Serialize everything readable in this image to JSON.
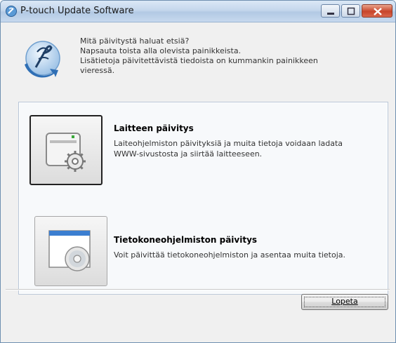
{
  "window": {
    "title": "P-touch Update Software"
  },
  "intro": {
    "line1": "Mitä päivitystä haluat etsiä?",
    "line2": "Napsauta toista alla olevista painikkeista.",
    "line3": "Lisätietoja päivitettävistä tiedoista on kummankin painikkeen",
    "line4": "vieressä."
  },
  "options": [
    {
      "title": "Laitteen päivitys",
      "desc_line1": "Laiteohjelmiston päivityksiä ja muita tietoja voidaan ladata",
      "desc_line2": "WWW-sivustosta ja siirtää laitteeseen.",
      "icon": "device-gear-icon"
    },
    {
      "title": "Tietokoneohjelmiston päivitys",
      "desc_line1": "Voit päivittää tietokoneohjelmiston ja asentaa muita tietoja.",
      "icon": "computer-cd-icon"
    }
  ],
  "footer": {
    "quit_label": "Lopeta"
  },
  "colors": {
    "titlebar": "#c5d7ec",
    "close_button": "#c7442a",
    "panel_border": "#b9c7d8",
    "accent_blue": "#2f6fb5"
  }
}
